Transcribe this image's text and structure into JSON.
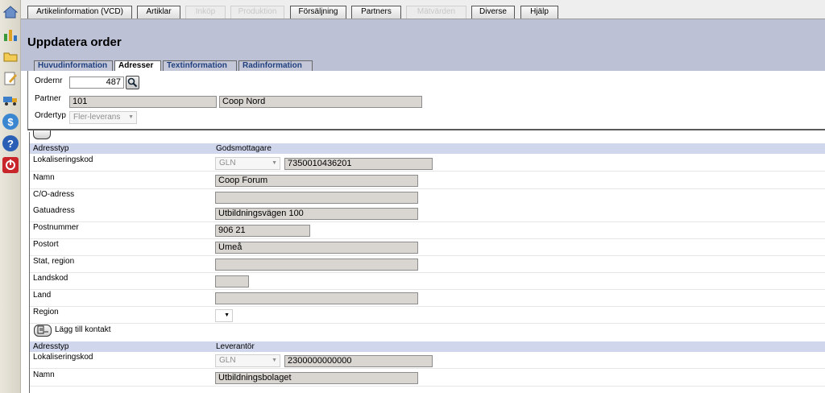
{
  "menu": {
    "items": [
      {
        "label": "Artikelinformation (VCD)",
        "disabled": false
      },
      {
        "label": "Artiklar",
        "disabled": false
      },
      {
        "label": "Inköp",
        "disabled": true
      },
      {
        "label": "Produktion",
        "disabled": true
      },
      {
        "label": "Försäljning",
        "disabled": false
      },
      {
        "label": "Partners",
        "disabled": false
      },
      {
        "label": "Mätvärden",
        "disabled": true
      },
      {
        "label": "Diverse",
        "disabled": false
      },
      {
        "label": "Hjälp",
        "disabled": false
      }
    ]
  },
  "sidebar": {
    "icons": [
      "home-icon",
      "chart-icon",
      "folder-icon",
      "edit-icon",
      "truck-icon",
      "dollar-icon",
      "help-icon",
      "power-icon"
    ]
  },
  "page": {
    "title": "Uppdatera order"
  },
  "tabs": [
    {
      "label": "Huvudinformation",
      "active": false
    },
    {
      "label": "Adresser",
      "active": true
    },
    {
      "label": "Textinformation",
      "active": false
    },
    {
      "label": "Radinformation",
      "active": false
    }
  ],
  "order": {
    "ordernr_label": "Ordernr",
    "ordernr_value": "487",
    "partner_label": "Partner",
    "partner_id": "101",
    "partner_name": "Coop Nord",
    "ordertyp_label": "Ordertyp",
    "ordertyp_value": "Fler-leverans"
  },
  "address1": {
    "type_label": "Adresstyp",
    "type_value": "Godsmottagare",
    "lok_label": "Lokaliseringskod",
    "lok_type": "GLN",
    "lok_value": "7350010436201",
    "namn_label": "Namn",
    "namn_value": "Coop Forum",
    "co_label": "C/O-adress",
    "co_value": "",
    "gatu_label": "Gatuadress",
    "gatu_value": "Utbildningsvägen 100",
    "postnr_label": "Postnummer",
    "postnr_value": "906 21",
    "postort_label": "Postort",
    "postort_value": "Umeå",
    "stat_label": "Stat, region",
    "stat_value": "",
    "landskod_label": "Landskod",
    "landskod_value": "",
    "land_label": "Land",
    "land_value": "",
    "region_label": "Region"
  },
  "add_contact": {
    "label": "Lägg till kontakt"
  },
  "address2": {
    "type_label": "Adresstyp",
    "type_value": "Leverantör",
    "lok_label": "Lokaliseringskod",
    "lok_type": "GLN",
    "lok_value": "2300000000000",
    "namn_label": "Namn",
    "namn_value": "Utbildningsbolaget"
  }
}
